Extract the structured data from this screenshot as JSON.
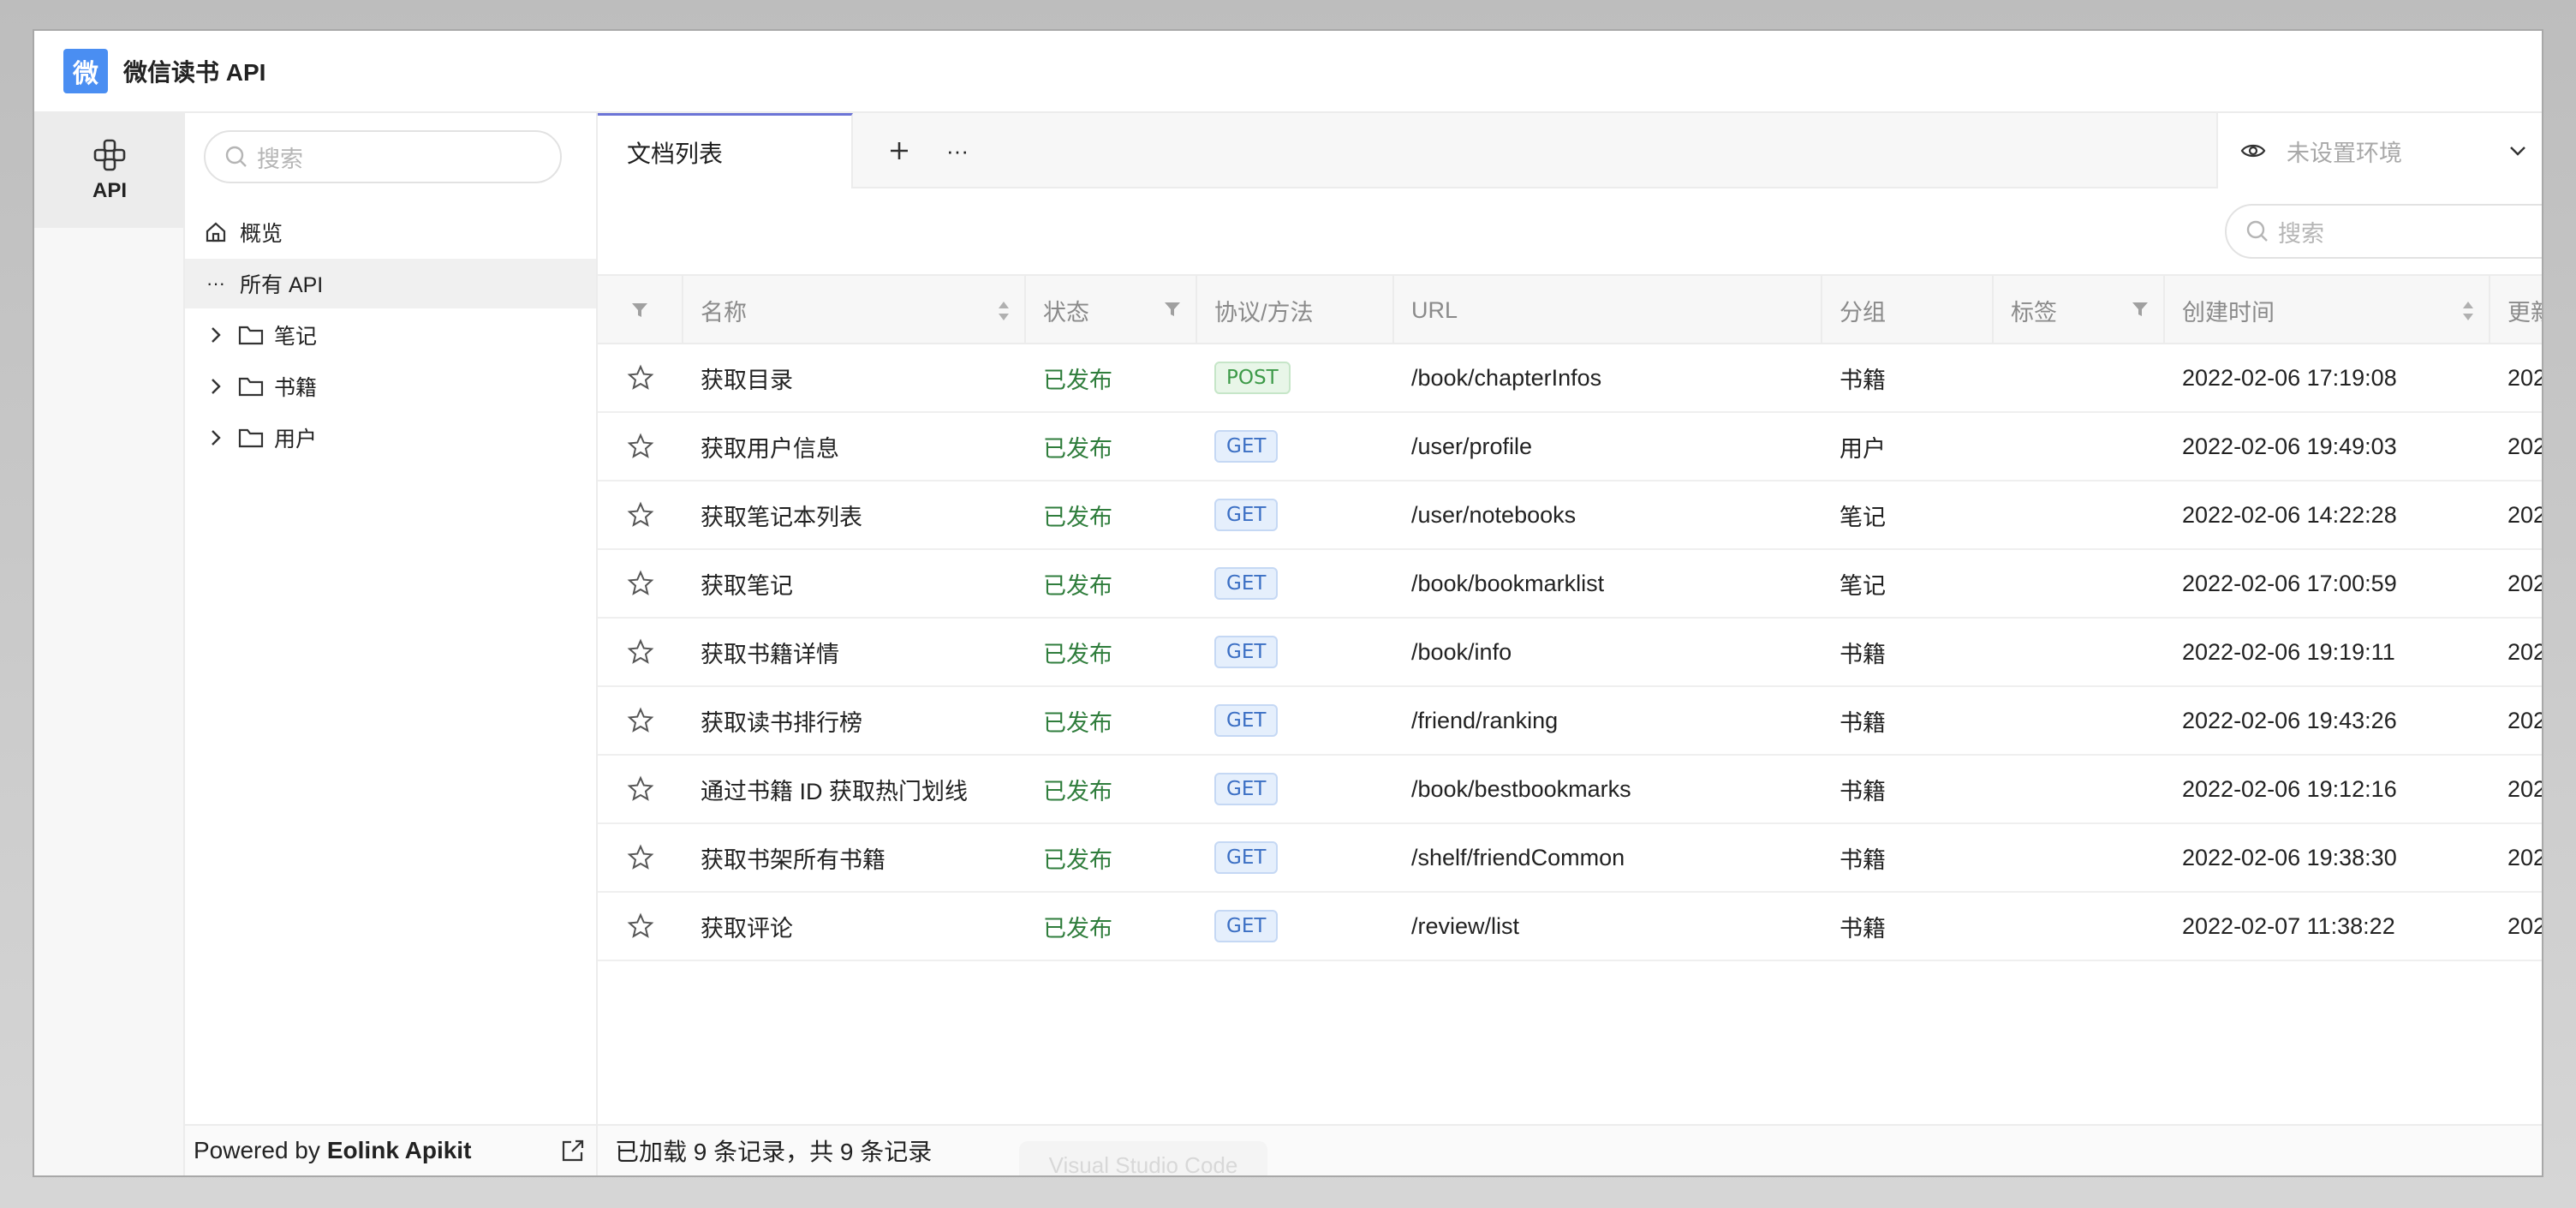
{
  "app": {
    "logo_char": "微",
    "title": "微信读书 API"
  },
  "rail": {
    "items": [
      {
        "label": "API",
        "icon": "api-icon"
      }
    ]
  },
  "tree": {
    "search_placeholder": "搜索",
    "overview": "概览",
    "all_api": "所有 API",
    "folders": [
      "笔记",
      "书籍",
      "用户"
    ],
    "footer_prefix": "Powered by",
    "footer_brand": "Eolink Apikit"
  },
  "tabs": {
    "active": "文档列表"
  },
  "env": {
    "label": "未设置环境"
  },
  "table": {
    "search_placeholder": "搜索",
    "columns": [
      "名称",
      "状态",
      "协议/方法",
      "URL",
      "分组",
      "标签",
      "创建时间",
      "更新"
    ],
    "rows": [
      {
        "name": "获取目录",
        "status": "已发布",
        "method": "POST",
        "url": "/book/chapterInfos",
        "group": "书籍",
        "created": "2022-02-06 17:19:08",
        "updated": "202"
      },
      {
        "name": "获取用户信息",
        "status": "已发布",
        "method": "GET",
        "url": "/user/profile",
        "group": "用户",
        "created": "2022-02-06 19:49:03",
        "updated": "202"
      },
      {
        "name": "获取笔记本列表",
        "status": "已发布",
        "method": "GET",
        "url": "/user/notebooks",
        "group": "笔记",
        "created": "2022-02-06 14:22:28",
        "updated": "202"
      },
      {
        "name": "获取笔记",
        "status": "已发布",
        "method": "GET",
        "url": "/book/bookmarklist",
        "group": "笔记",
        "created": "2022-02-06 17:00:59",
        "updated": "202"
      },
      {
        "name": "获取书籍详情",
        "status": "已发布",
        "method": "GET",
        "url": "/book/info",
        "group": "书籍",
        "created": "2022-02-06 19:19:11",
        "updated": "202"
      },
      {
        "name": "获取读书排行榜",
        "status": "已发布",
        "method": "GET",
        "url": "/friend/ranking",
        "group": "书籍",
        "created": "2022-02-06 19:43:26",
        "updated": "202"
      },
      {
        "name": "通过书籍 ID 获取热门划线",
        "status": "已发布",
        "method": "GET",
        "url": "/book/bestbookmarks",
        "group": "书籍",
        "created": "2022-02-06 19:12:16",
        "updated": "202"
      },
      {
        "name": "获取书架所有书籍",
        "status": "已发布",
        "method": "GET",
        "url": "/shelf/friendCommon",
        "group": "书籍",
        "created": "2022-02-06 19:38:30",
        "updated": "202"
      },
      {
        "name": "获取评论",
        "status": "已发布",
        "method": "GET",
        "url": "/review/list",
        "group": "书籍",
        "created": "2022-02-07 11:38:22",
        "updated": "202"
      }
    ],
    "footer": "已加载 9 条记录，共 9 条记录"
  },
  "overlay": {
    "ghost_label": "Visual Studio Code"
  },
  "colors": {
    "accent": "#4a8ef2",
    "tab_indicator": "#6c74d6",
    "status_green": "#2f7d3c"
  }
}
